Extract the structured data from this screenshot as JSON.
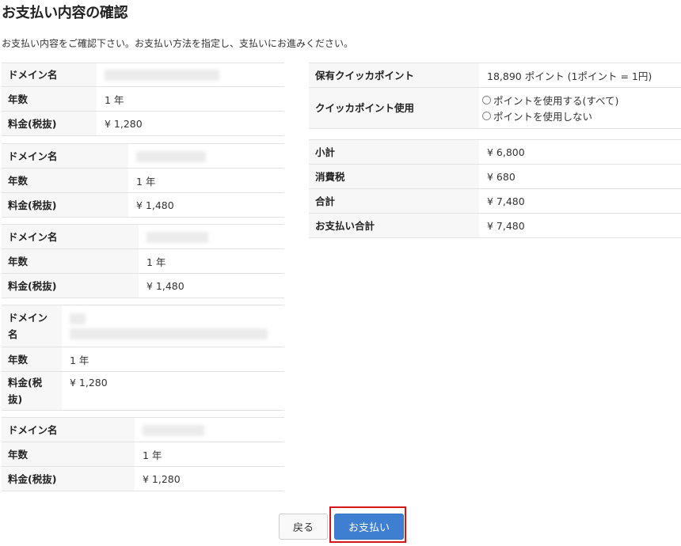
{
  "page": {
    "title": "お支払い内容の確認",
    "intro": "お支払い内容をご確認下さい。お支払い方法を指定し、支払いにお進みください。"
  },
  "labels": {
    "domain": "ドメイン名",
    "domain_wrapped_1": "ドメイン",
    "domain_wrapped_2": "名",
    "years": "年数",
    "fee": "料金(税抜)",
    "fee_wrapped_1": "料金(税",
    "fee_wrapped_2": "抜)"
  },
  "domains": [
    {
      "years": "1 年",
      "fee": "¥ 1,280"
    },
    {
      "years": "1 年",
      "fee": "¥ 1,480"
    },
    {
      "years": "1 年",
      "fee": "¥ 1,480"
    },
    {
      "years": "1 年",
      "fee": "¥ 1,280"
    },
    {
      "years": "1 年",
      "fee": "¥ 1,280"
    }
  ],
  "points": {
    "held_label": "保有クイッカポイント",
    "held_value": "18,890 ポイント (1ポイント = 1円)",
    "use_label": "クイッカポイント使用",
    "options": [
      "ポイントを使用する(すべて)",
      "ポイントを使用しない"
    ]
  },
  "summary": {
    "subtotal_label": "小計",
    "subtotal_value": "¥ 6,800",
    "tax_label": "消費税",
    "tax_value": "¥ 680",
    "total_label": "合計",
    "total_value": "¥ 7,480",
    "payment_total_label": "お支払い合計",
    "payment_total_value": "¥ 7,480"
  },
  "buttons": {
    "back": "戻る",
    "pay": "お支払い"
  }
}
